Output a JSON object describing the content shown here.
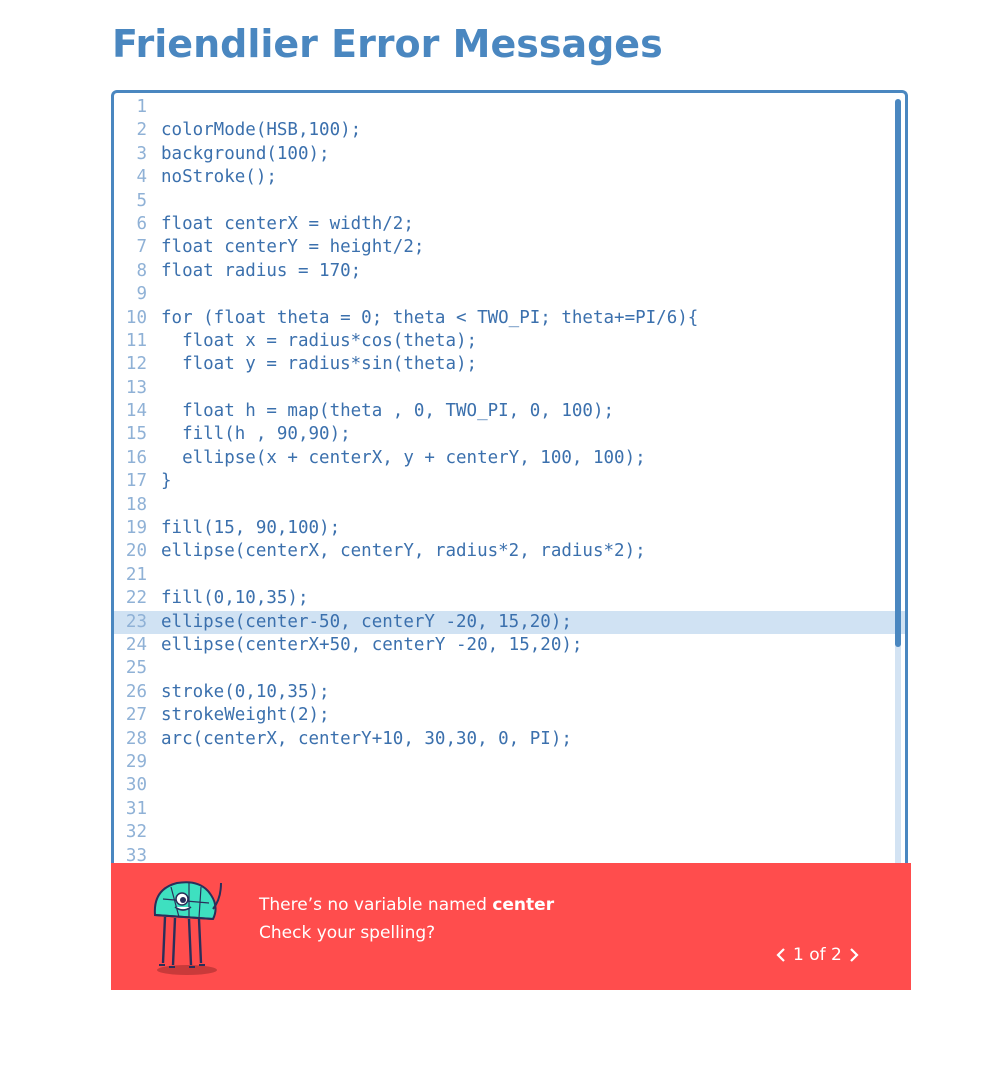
{
  "page": {
    "title": "Friendlier Error Messages"
  },
  "editor": {
    "highlighted_line": 23,
    "lines": [
      {
        "n": "1",
        "t": ""
      },
      {
        "n": "2",
        "t": "colorMode(HSB,100);"
      },
      {
        "n": "3",
        "t": "background(100);"
      },
      {
        "n": "4",
        "t": "noStroke();"
      },
      {
        "n": "5",
        "t": ""
      },
      {
        "n": "6",
        "t": "float centerX = width/2;"
      },
      {
        "n": "7",
        "t": "float centerY = height/2;"
      },
      {
        "n": "8",
        "t": "float radius = 170;"
      },
      {
        "n": "9",
        "t": ""
      },
      {
        "n": "10",
        "t": "for (float theta = 0; theta < TWO_PI; theta+=PI/6){"
      },
      {
        "n": "11",
        "t": "  float x = radius*cos(theta);"
      },
      {
        "n": "12",
        "t": "  float y = radius*sin(theta);"
      },
      {
        "n": "13",
        "t": ""
      },
      {
        "n": "14",
        "t": "  float h = map(theta , 0, TWO_PI, 0, 100);"
      },
      {
        "n": "15",
        "t": "  fill(h , 90,90);"
      },
      {
        "n": "16",
        "t": "  ellipse(x + centerX, y + centerY, 100, 100);"
      },
      {
        "n": "17",
        "t": "}"
      },
      {
        "n": "18",
        "t": ""
      },
      {
        "n": "19",
        "t": "fill(15, 90,100);"
      },
      {
        "n": "20",
        "t": "ellipse(centerX, centerY, radius*2, radius*2);"
      },
      {
        "n": "21",
        "t": ""
      },
      {
        "n": "22",
        "t": "fill(0,10,35);"
      },
      {
        "n": "23",
        "t": "ellipse(center-50, centerY -20, 15,20);"
      },
      {
        "n": "24",
        "t": "ellipse(centerX+50, centerY -20, 15,20);"
      },
      {
        "n": "25",
        "t": ""
      },
      {
        "n": "26",
        "t": "stroke(0,10,35);"
      },
      {
        "n": "27",
        "t": "strokeWeight(2);"
      },
      {
        "n": "28",
        "t": "arc(centerX, centerY+10, 30,30, 0, PI);"
      },
      {
        "n": "29",
        "t": ""
      },
      {
        "n": "30",
        "t": ""
      },
      {
        "n": "31",
        "t": ""
      },
      {
        "n": "32",
        "t": ""
      },
      {
        "n": "33",
        "t": ""
      }
    ]
  },
  "error": {
    "message_prefix": "There’s no variable named ",
    "variable": "center",
    "hint": "Check your spelling?",
    "pager_text": "1 of 2",
    "prev_icon": "chevron-left-icon",
    "next_icon": "chevron-right-icon",
    "mascot_icon": "mascot-icon"
  },
  "colors": {
    "accent": "#4a87c0",
    "code_text": "#3b70ad",
    "line_number": "#8fb1d6",
    "highlight": "#d0e2f3",
    "error_bg": "#ff4d4d",
    "mascot": "#3ee0c0"
  }
}
